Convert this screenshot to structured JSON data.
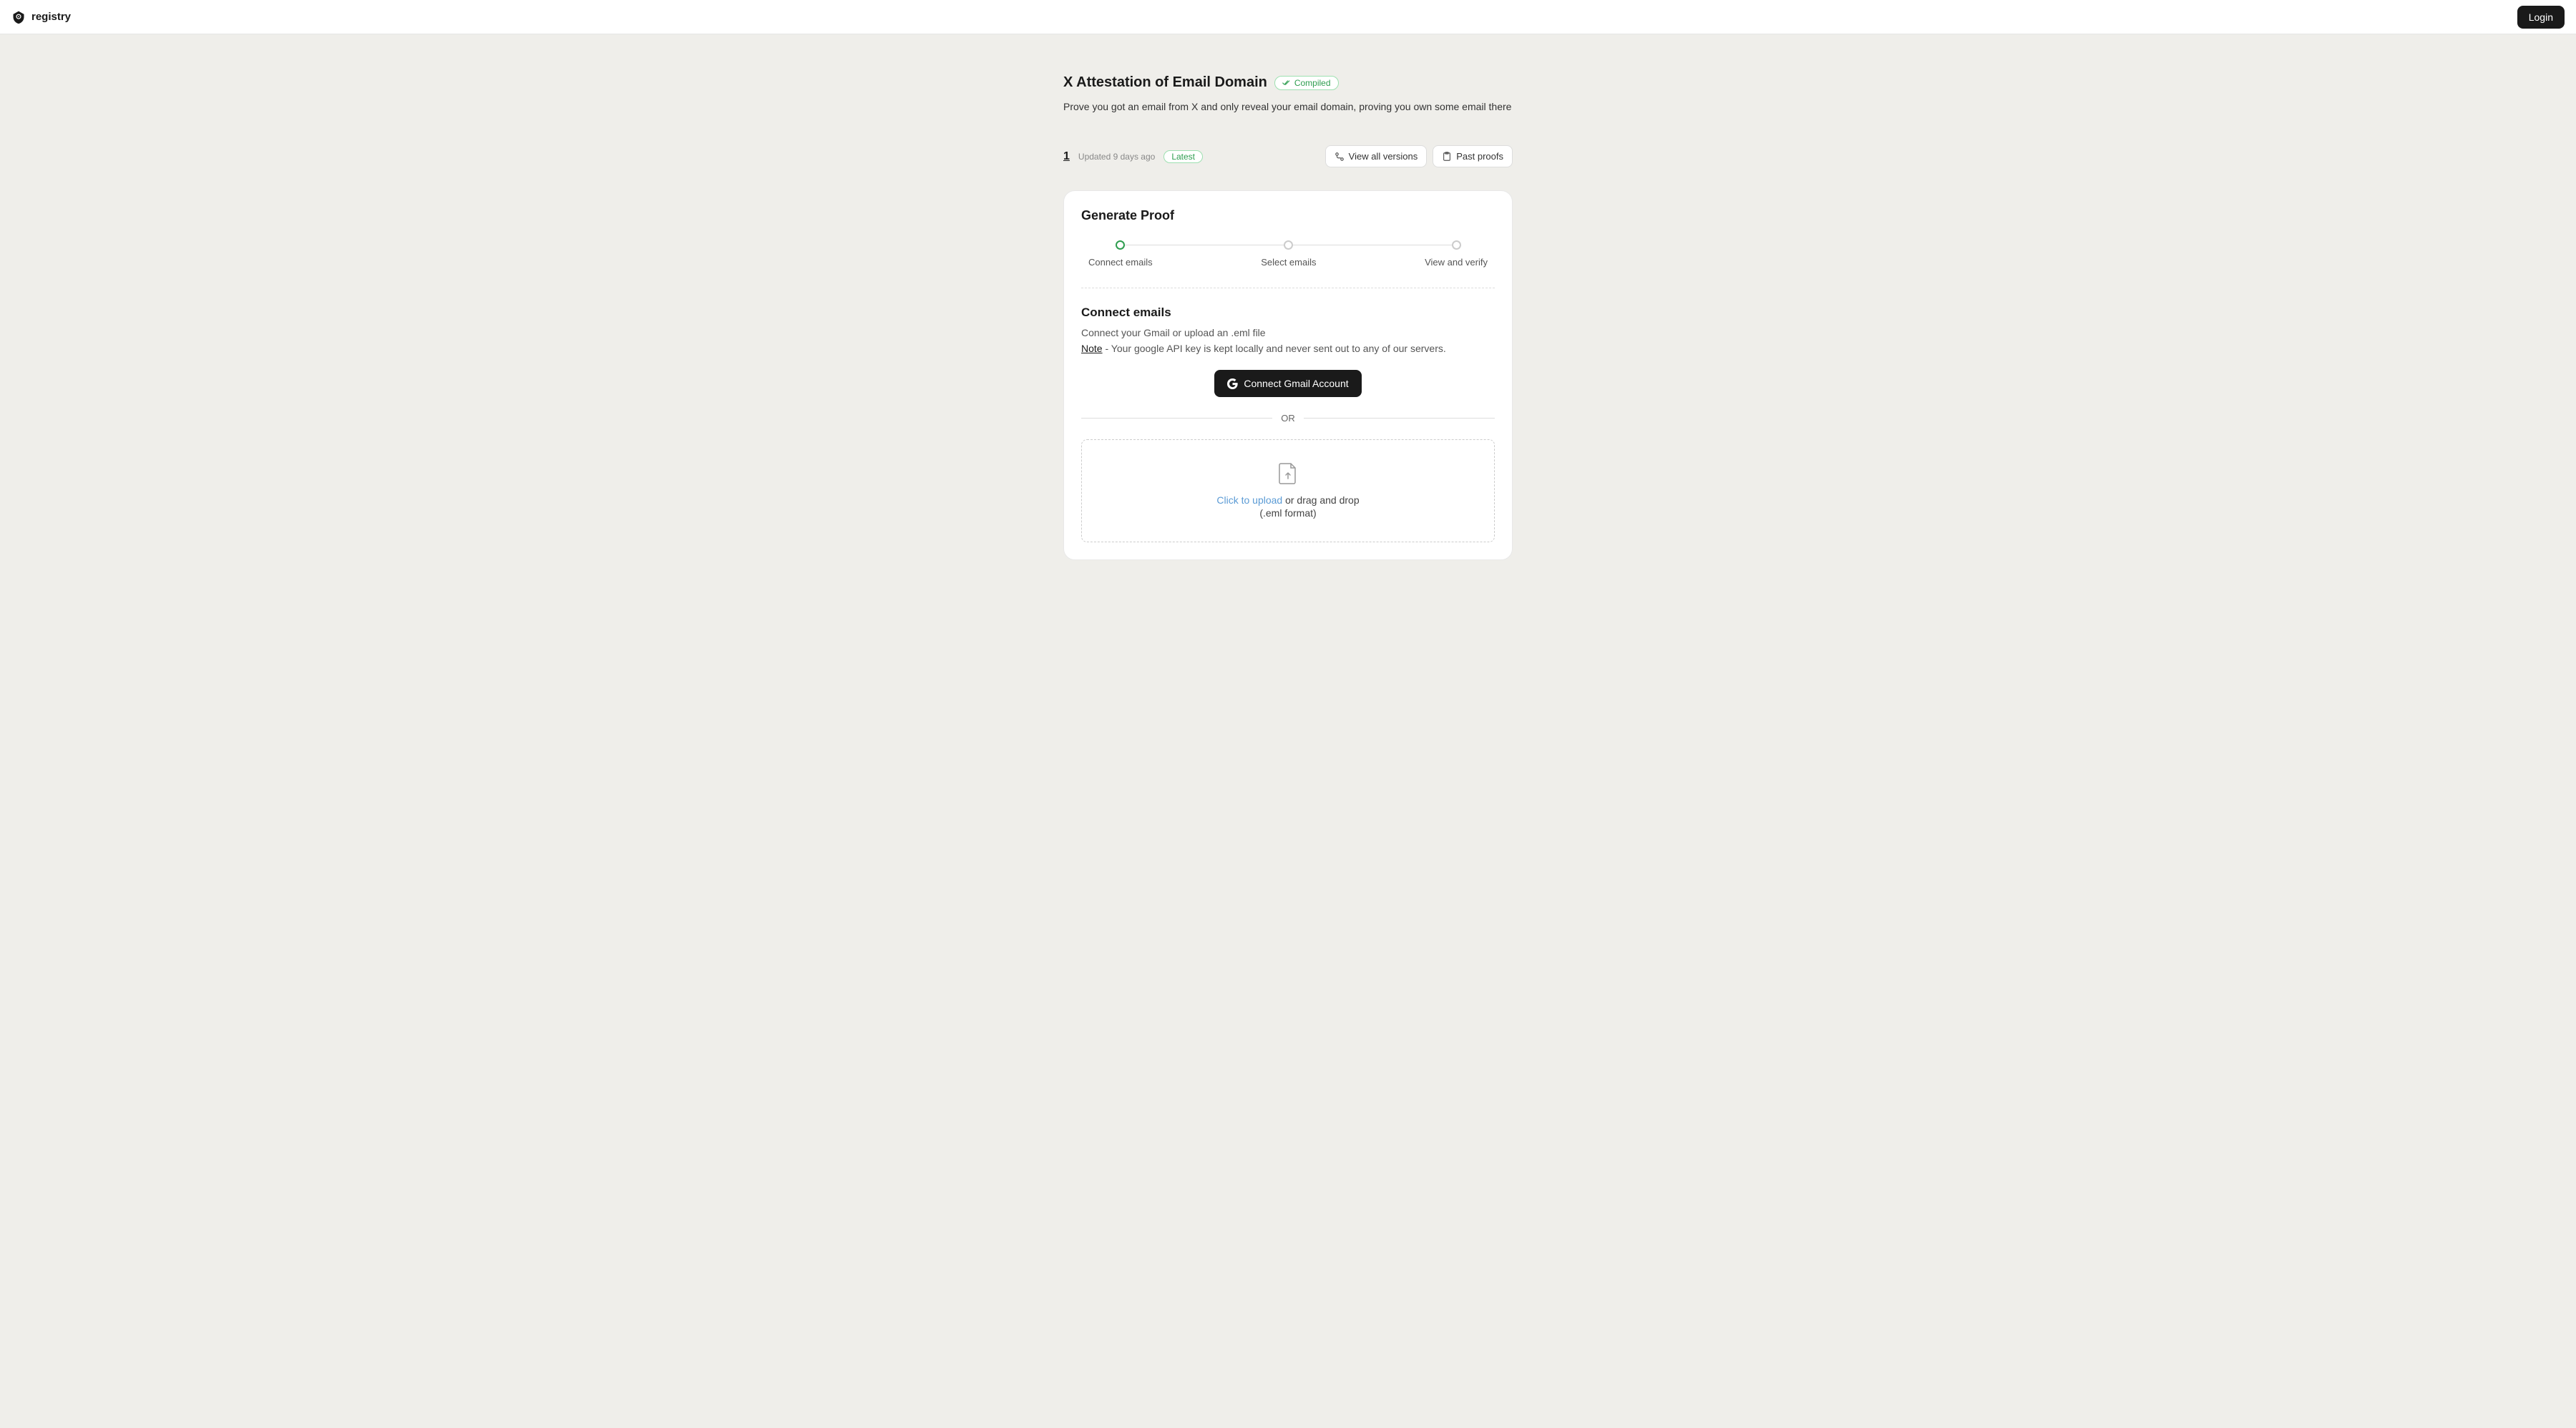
{
  "header": {
    "brand": "registry",
    "login": "Login"
  },
  "page": {
    "title": "X Attestation of Email Domain",
    "compiled_badge": "Compiled",
    "subtitle": "Prove you got an email from X and only reveal your email domain, proving you own some email there"
  },
  "meta": {
    "version": "1",
    "updated": "Updated 9 days ago",
    "latest_badge": "Latest",
    "view_versions": "View all versions",
    "past_proofs": "Past proofs"
  },
  "card": {
    "title": "Generate Proof",
    "steps": [
      "Connect emails",
      "Select emails",
      "View and verify"
    ]
  },
  "connect": {
    "title": "Connect emails",
    "desc": "Connect your Gmail or upload an .eml file",
    "note_label": "Note",
    "note_text": " - Your google API key is kept locally and never sent out to any of our servers.",
    "gmail_btn": "Connect Gmail Account",
    "or": "OR",
    "upload_link": "Click to upload",
    "upload_rest": " or drag and drop",
    "upload_format": "(.eml format)"
  }
}
